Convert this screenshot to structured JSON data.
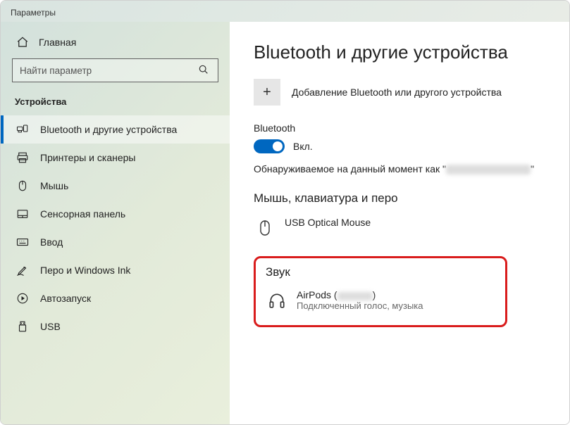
{
  "window": {
    "title": "Параметры"
  },
  "sidebar": {
    "home": "Главная",
    "search_placeholder": "Найти параметр",
    "category": "Устройства",
    "items": [
      {
        "label": "Bluetooth и другие устройства",
        "icon": "bluetooth-devices-icon",
        "active": true
      },
      {
        "label": "Принтеры и сканеры",
        "icon": "printer-icon",
        "active": false
      },
      {
        "label": "Мышь",
        "icon": "mouse-icon",
        "active": false
      },
      {
        "label": "Сенсорная панель",
        "icon": "touchpad-icon",
        "active": false
      },
      {
        "label": "Ввод",
        "icon": "keyboard-icon",
        "active": false
      },
      {
        "label": "Перо и Windows Ink",
        "icon": "pen-icon",
        "active": false
      },
      {
        "label": "Автозапуск",
        "icon": "autoplay-icon",
        "active": false
      },
      {
        "label": "USB",
        "icon": "usb-icon",
        "active": false
      }
    ]
  },
  "main": {
    "heading": "Bluetooth и другие устройства",
    "add_label": "Добавление Bluetooth или другого устройства",
    "add_symbol": "+",
    "bluetooth_label": "Bluetooth",
    "toggle_state": "Вкл.",
    "discoverable_prefix": "Обнаруживаемое на данный момент как \"",
    "discoverable_suffix": "\"",
    "section_mouse": "Мышь, клавиатура и перо",
    "device_mouse": {
      "name": "USB Optical Mouse"
    },
    "section_sound": "Звук",
    "device_airpods": {
      "name_prefix": "AirPods (",
      "name_suffix": ")",
      "status": "Подключенный голос, музыка"
    }
  }
}
